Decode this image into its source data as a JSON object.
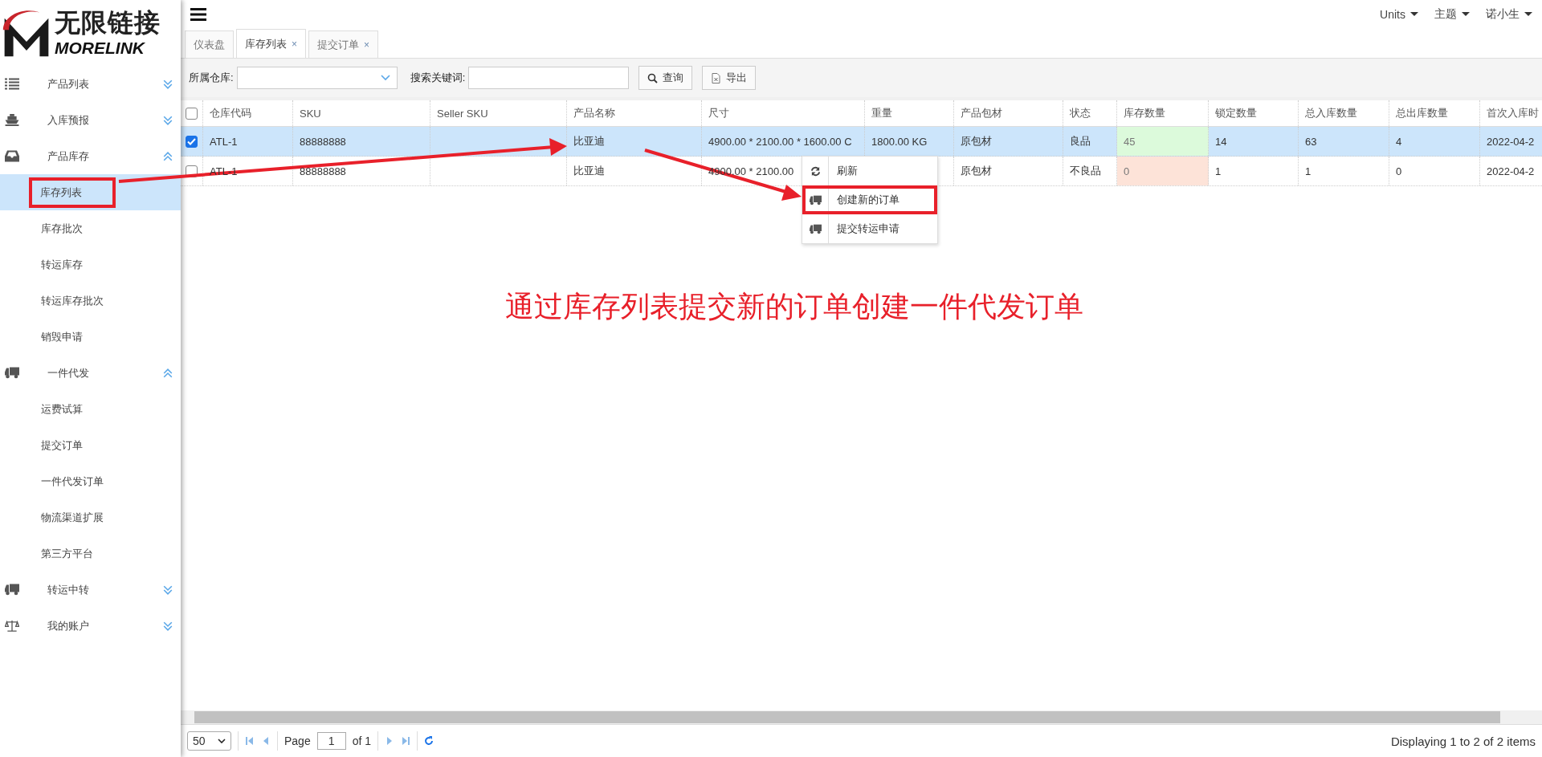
{
  "logo": {
    "title": "无限链接",
    "subtitle": "MORELINK"
  },
  "sidebar": {
    "items": [
      {
        "label": "产品列表",
        "kind": "list",
        "expanded": false
      },
      {
        "label": "入库预报",
        "kind": "ship",
        "expanded": false
      },
      {
        "label": "产品库存",
        "kind": "inbox",
        "expanded": true,
        "children": [
          {
            "label": "库存列表",
            "selected": true,
            "highlighted": true
          },
          {
            "label": "库存批次",
            "selected": false,
            "highlighted": false
          },
          {
            "label": "转运库存",
            "selected": false,
            "highlighted": false
          },
          {
            "label": "转运库存批次",
            "selected": false,
            "highlighted": false
          },
          {
            "label": "销毁申请",
            "selected": false,
            "highlighted": false
          }
        ]
      },
      {
        "label": "一件代发",
        "kind": "truck",
        "expanded": true,
        "children": [
          {
            "label": "运费试算",
            "selected": false,
            "highlighted": false
          },
          {
            "label": "提交订单",
            "selected": false,
            "highlighted": false
          },
          {
            "label": "一件代发订单",
            "selected": false,
            "highlighted": false
          },
          {
            "label": "物流渠道扩展",
            "selected": false,
            "highlighted": false
          },
          {
            "label": "第三方平台",
            "selected": false,
            "highlighted": false
          }
        ]
      },
      {
        "label": "转运中转",
        "kind": "truck",
        "expanded": false
      },
      {
        "label": "我的账户",
        "kind": "scale",
        "expanded": false
      }
    ]
  },
  "top_menu": [
    {
      "label": "Units"
    },
    {
      "label": "主题"
    },
    {
      "label": "诺小生"
    }
  ],
  "tabs": [
    {
      "label": "仪表盘",
      "selected": false
    },
    {
      "label": "库存列表",
      "selected": true,
      "close": "×"
    },
    {
      "label": "提交订单",
      "selected": false,
      "close": "×"
    }
  ],
  "toolbar": {
    "warehouse_label": "所属仓库:",
    "keyword_label": "搜索关键词:",
    "buttons": [
      {
        "label": "查询",
        "kind": "search"
      },
      {
        "label": "导出",
        "kind": "excel"
      }
    ]
  },
  "table": {
    "header_checked": false,
    "columns": [
      "仓库代码",
      "SKU",
      "Seller SKU",
      "产品名称",
      "尺寸",
      "重量",
      "产品包材",
      "状态",
      "库存数量",
      "锁定数量",
      "总入库数量",
      "总出库数量",
      "首次入库时"
    ],
    "rows": [
      {
        "selected": true,
        "color": "#dcfadb",
        "cells": [
          "ATL-1",
          "88888888",
          "",
          "比亚迪",
          "4900.00 * 2100.00 * 1600.00 C",
          "1800.00 KG",
          "原包材",
          "良品",
          "45",
          "14",
          "63",
          "4",
          "2022-04-2"
        ]
      },
      {
        "selected": false,
        "color": "#fde3d8",
        "cells": [
          "ATL-1",
          "88888888",
          "",
          "比亚迪",
          "4900.00 * 2100.00",
          "",
          "原包材",
          "不良品",
          "0",
          "1",
          "1",
          "0",
          "2022-04-2"
        ]
      }
    ]
  },
  "context_menu": [
    {
      "label": "刷新",
      "kind": "refresh",
      "highlighted": false
    },
    {
      "label": "创建新的订单",
      "kind": "truck",
      "highlighted": true
    },
    {
      "label": "提交转运申请",
      "kind": "truck",
      "highlighted": false
    }
  ],
  "annotation": {
    "caption": "通过库存列表提交新的订单创建一件代发订单"
  },
  "pager": {
    "page_size": "50",
    "page_label": "Page",
    "page": "1",
    "of": "of 1",
    "summary": "Displaying 1 to 2 of 2 items"
  }
}
